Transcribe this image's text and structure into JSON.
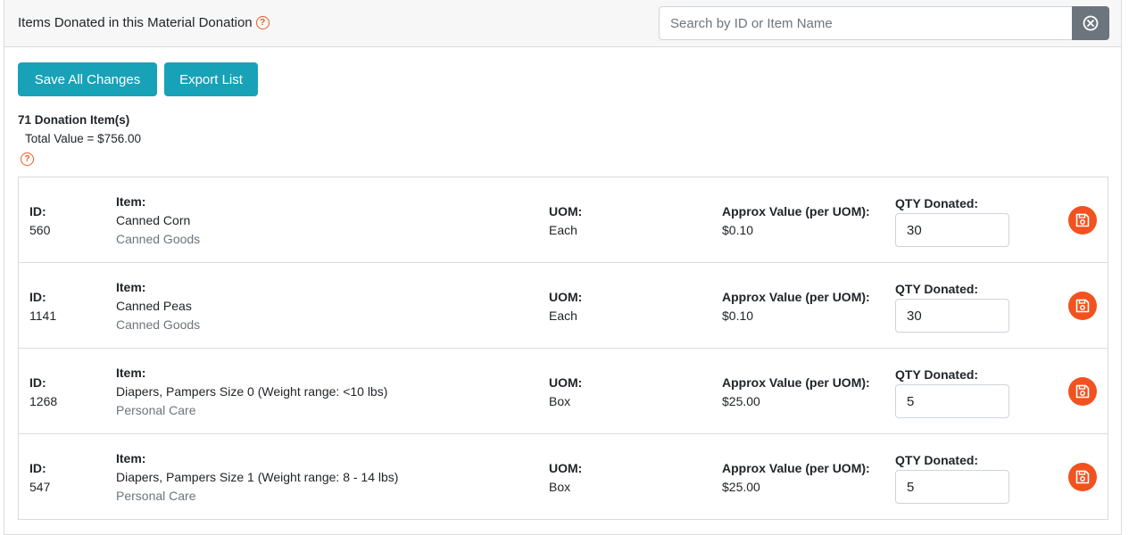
{
  "header": {
    "title": "Items Donated in this Material Donation",
    "help_glyph": "?"
  },
  "search": {
    "placeholder": "Search by ID or Item Name",
    "value": ""
  },
  "toolbar": {
    "save_all_label": "Save All Changes",
    "export_label": "Export List"
  },
  "summary": {
    "count_text": "71 Donation Item(s)",
    "total_text": "Total Value = $756.00",
    "help_glyph": "?"
  },
  "labels": {
    "id": "ID:",
    "item": "Item:",
    "uom": "UOM:",
    "value": "Approx Value (per UOM):",
    "qty": "QTY Donated:"
  },
  "items": [
    {
      "id": "560",
      "name": "Canned Corn",
      "category": "Canned Goods",
      "uom": "Each",
      "value": "$0.10",
      "qty": "30"
    },
    {
      "id": "1141",
      "name": "Canned Peas",
      "category": "Canned Goods",
      "uom": "Each",
      "value": "$0.10",
      "qty": "30"
    },
    {
      "id": "1268",
      "name": "Diapers, Pampers Size 0 (Weight range: <10 lbs)",
      "category": "Personal Care",
      "uom": "Box",
      "value": "$25.00",
      "qty": "5"
    },
    {
      "id": "547",
      "name": "Diapers, Pampers Size 1 (Weight range: 8 - 14 lbs)",
      "category": "Personal Care",
      "uom": "Box",
      "value": "$25.00",
      "qty": "5"
    }
  ],
  "icons": {
    "help": "question-circle-icon",
    "clear": "times-circle-icon",
    "save": "floppy-disk-icon"
  },
  "colors": {
    "accent": "#17a2b8",
    "save_icon": "#f1521f",
    "help_icon": "#ec5a24",
    "clear_button": "#6c757d"
  }
}
